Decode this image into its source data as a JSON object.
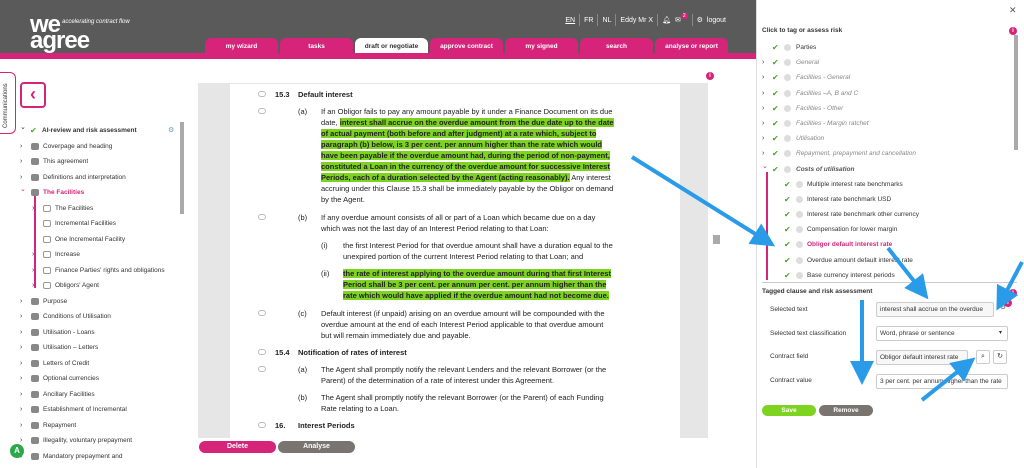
{
  "brand": {
    "logo_line1": "we",
    "logo_line2": "agree",
    "tagline": "accelerating contract flow"
  },
  "topbar": {
    "languages": [
      "EN",
      "FR",
      "NL"
    ],
    "user": "Eddy Mr X",
    "notification_count": "2",
    "logout": "logout"
  },
  "nav_tabs": [
    "my wizard",
    "tasks",
    "draft or negotiate",
    "approve contract",
    "my signed contracts",
    "search",
    "analyse or report"
  ],
  "side_tab": "Communications",
  "tree": [
    {
      "label": "AI-review and risk assessment",
      "state": "open-checked",
      "style": "bold"
    },
    {
      "label": "Coverpage and heading",
      "state": "closed"
    },
    {
      "label": "This agreement",
      "state": "closed"
    },
    {
      "label": "Definitions and interpretation",
      "state": "closed"
    },
    {
      "label": "The Facilities",
      "state": "open",
      "style": "pink"
    },
    {
      "label": "The Facilities",
      "state": "closed",
      "sub": true
    },
    {
      "label": "Incremental Facilities",
      "state": "leaf",
      "sub": true
    },
    {
      "label": "One Incremental Facility",
      "state": "leaf",
      "sub": true
    },
    {
      "label": "Increase",
      "state": "closed",
      "sub": true
    },
    {
      "label": "Finance Parties' rights and obligations",
      "state": "closed",
      "sub": true
    },
    {
      "label": "Obligors' Agent",
      "state": "closed",
      "sub": true
    },
    {
      "label": "Purpose",
      "state": "closed"
    },
    {
      "label": "Conditions of Utilisation",
      "state": "closed"
    },
    {
      "label": "Utilisation - Loans",
      "state": "closed"
    },
    {
      "label": "Utilisation – Letters",
      "state": "closed"
    },
    {
      "label": "Letters of Credit",
      "state": "closed"
    },
    {
      "label": "Optional currencies",
      "state": "closed"
    },
    {
      "label": "Ancillary Facilities",
      "state": "closed"
    },
    {
      "label": "Establishment of Incremental",
      "state": "closed"
    },
    {
      "label": "Repayment",
      "state": "closed"
    },
    {
      "label": "Illegality, voluntary prepayment",
      "state": "closed"
    },
    {
      "label": "Mandatory prepayment and",
      "state": "closed"
    }
  ],
  "document": {
    "h153_num": "15.3",
    "h153_title": "Default interest",
    "a_label": "(a)",
    "a_l1": "If an Obligor fails to pay any amount payable by it under a Finance Document on its due",
    "a_l2_pre": "date, ",
    "a_l2_hl": "interest shall accrue on the overdue amount from the due date up to the date",
    "a_l3_hl": "of actual payment (both before and after judgment) at a rate which, subject to",
    "a_l4_hl": "paragraph (b) below, is 3 per cent. per annum higher than the rate which would",
    "a_l5_hl": "have been payable if the overdue amount had, during the period of non-payment,",
    "a_l6_hl": "constituted a Loan in the currency of the overdue amount for successive Interest",
    "a_l7_hl": "Periods, each of a duration selected by the Agent (acting reasonably).",
    "a_l7_post": " Any interest",
    "a_l8": "accruing under this Clause 15.3 shall be immediately payable by the Obligor on demand",
    "a_l9": "by the Agent.",
    "b_label": "(b)",
    "b_l1": "If any overdue amount consists of all or part of a Loan which became due on a day",
    "b_l2": "which was not the last day of an Interest Period relating to that Loan:",
    "bi_label": "(i)",
    "bi_l1": "the first Interest Period for that overdue amount shall have a duration equal to the",
    "bi_l2": "unexpired portion of the current Interest Period relating to that Loan; and",
    "bii_label": "(ii)",
    "bii_l1": "the rate of interest applying to the overdue amount during that first Interest",
    "bii_l2": "Period shall be 3 per cent. per annum per cent. per annum higher than the",
    "bii_l3": "rate which would have applied if the overdue amount had not become due.",
    "c_label": "(c)",
    "c_l1": "Default interest (if unpaid) arising on an overdue amount will be compounded with the",
    "c_l2": "overdue amount at the end of each Interest Period applicable to that overdue amount",
    "c_l3": "but will remain immediately due and payable.",
    "h154_num": "15.4",
    "h154_title": "Notification of rates of interest",
    "n_a_label": "(a)",
    "n_a_l1": "The Agent shall promptly notify the relevant Lenders and the relevant Borrower (or the",
    "n_a_l2": "Parent) of the determination of a rate of interest under this Agreement.",
    "n_b_label": "(b)",
    "n_b_l1": "The Agent shall promptly notify the relevant Borrower (or the Parent) of each Funding",
    "n_b_l2": "Rate relating to a Loan.",
    "h16_num": "16.",
    "h16_title": "Interest Periods"
  },
  "buttons": {
    "delete": "Delete",
    "analyse": "Analyse",
    "save": "Save",
    "remove": "Remove"
  },
  "avatar_letter": "A",
  "info_glyph": "i",
  "panel": {
    "title": "Click to tag or assess risk",
    "items": [
      {
        "label": "Parties",
        "arrow": "",
        "style": ""
      },
      {
        "label": "General",
        "arrow": ">",
        "style": "it"
      },
      {
        "label": "Facilities - General",
        "arrow": ">",
        "style": "it"
      },
      {
        "label": "Facilities –A, B and C",
        "arrow": ">",
        "style": "it"
      },
      {
        "label": "Facilities - Other",
        "arrow": ">",
        "style": "it"
      },
      {
        "label": "Facilities - Margin ratchet",
        "arrow": ">",
        "style": "it"
      },
      {
        "label": "Utilisation",
        "arrow": ">",
        "style": "it"
      },
      {
        "label": "Repayment, prepayment and cancellation",
        "arrow": ">",
        "style": "it"
      },
      {
        "label": "Costs of utilisation",
        "arrow": "v",
        "style": "bi"
      },
      {
        "label": "Multiple interest rate benchmarks",
        "arrow": "",
        "style": "sub"
      },
      {
        "label": "Interest rate benchmark USD",
        "arrow": "",
        "style": "sub"
      },
      {
        "label": "Interest rate benchmark other currency",
        "arrow": "",
        "style": "sub"
      },
      {
        "label": "Compensation for lower margin",
        "arrow": "",
        "style": "sub"
      },
      {
        "label": "Obligor default interest rate",
        "arrow": "",
        "style": "sel"
      },
      {
        "label": "Overdue amount default interest rate",
        "arrow": "",
        "style": "sub"
      },
      {
        "label": "Base currency interest periods",
        "arrow": "",
        "style": "sub"
      }
    ],
    "tagged_title": "Tagged clause and risk assessment",
    "fields": {
      "selected_text_label": "Selected text",
      "selected_text_value": "interest shall accrue on the overdue",
      "classification_label": "Selected text classification",
      "classification_value": "Word, phrase or sentence",
      "contract_field_label": "Contract field",
      "contract_field_value": "Obligor default interest rate",
      "contract_value_label": "Contract value",
      "contract_value_value": "3 per cent. per annum higher than the rate"
    }
  },
  "colors": {
    "brand_pink": "#d6247a",
    "highlight_green": "#7ed321",
    "arrow_blue": "#2a9be8",
    "header_grey": "#5a5a5a"
  }
}
